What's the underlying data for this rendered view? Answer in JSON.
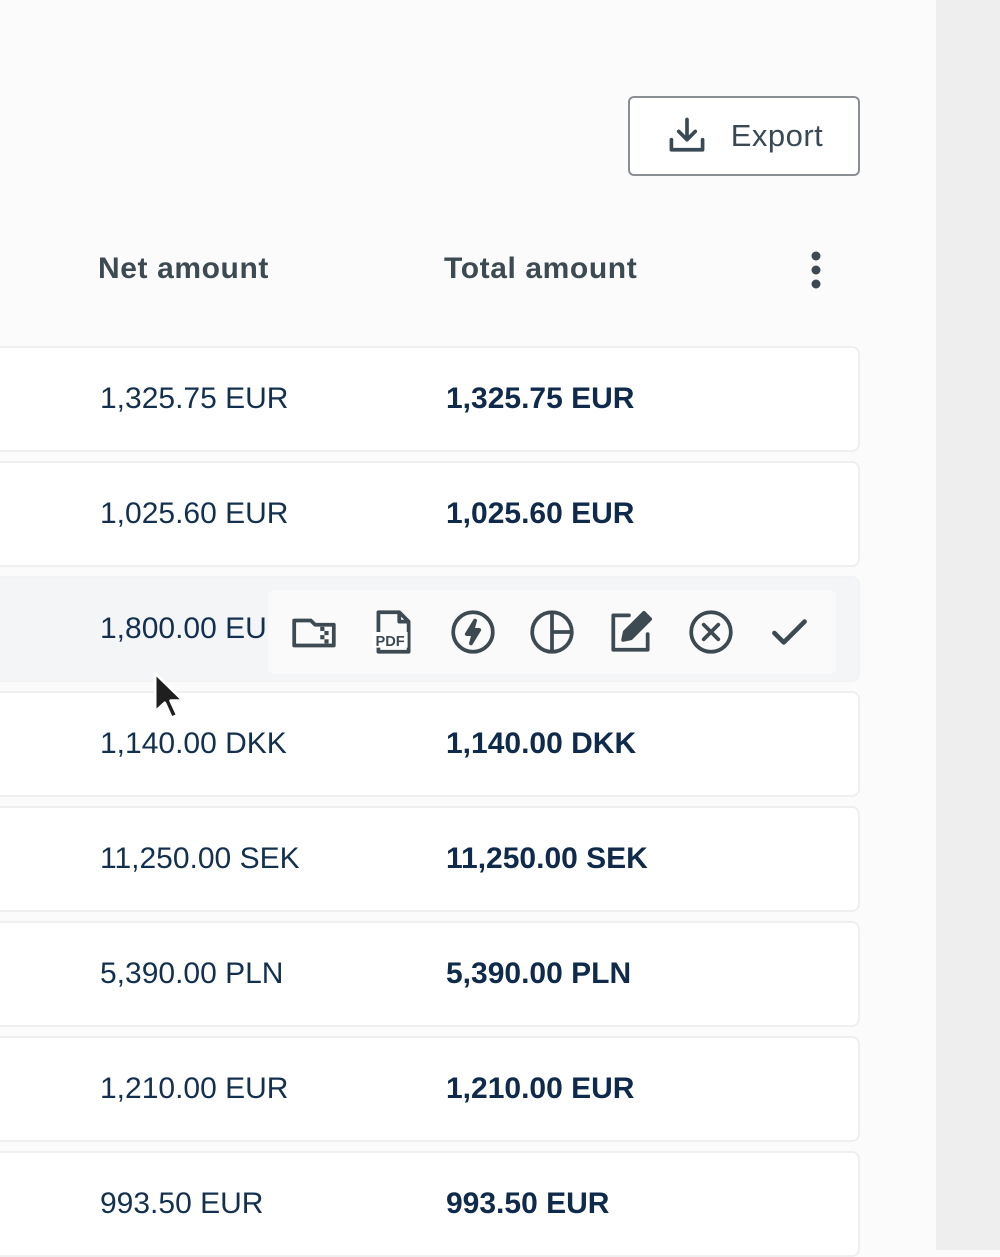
{
  "toolbar": {
    "export_label": "Export"
  },
  "table": {
    "headers": {
      "net": "Net amount",
      "total": "Total amount"
    },
    "rows": [
      {
        "net": "1,325.75 EUR",
        "total": "1,325.75 EUR"
      },
      {
        "net": "1,025.60 EUR",
        "total": "1,025.60 EUR"
      },
      {
        "net": "1,800.00 EU",
        "total": ""
      },
      {
        "net": "1,140.00 DKK",
        "total": "1,140.00 DKK"
      },
      {
        "net": "11,250.00 SEK",
        "total": "11,250.00 SEK"
      },
      {
        "net": "5,390.00 PLN",
        "total": "5,390.00 PLN"
      },
      {
        "net": "1,210.00 EUR",
        "total": "1,210.00 EUR"
      },
      {
        "net": "993.50 EUR",
        "total": "993.50 EUR"
      }
    ]
  },
  "row_actions": {
    "icons": [
      "folder-zip-icon",
      "pdf-icon",
      "lightning-icon",
      "pie-chart-icon",
      "edit-icon",
      "cancel-icon",
      "check-icon"
    ],
    "pdf_text": "PDF"
  },
  "colors": {
    "text_primary": "#0f2a4a",
    "header": "#3e4a52",
    "row_hover": "#f4f5f6"
  }
}
